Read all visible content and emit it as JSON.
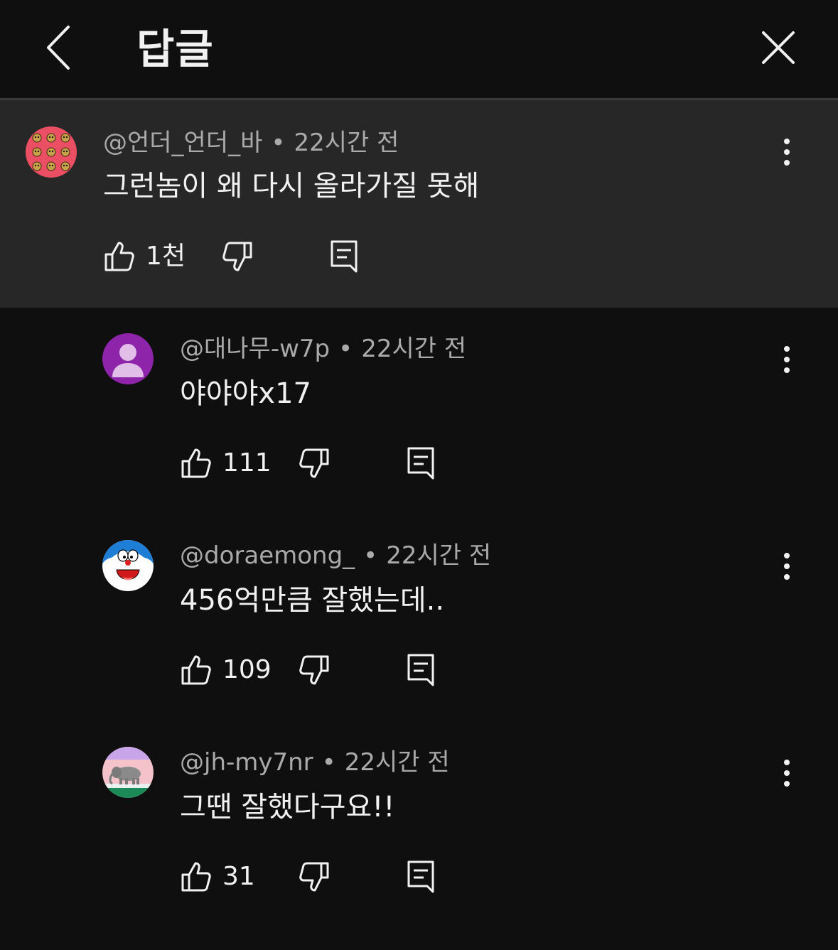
{
  "header": {
    "title": "답글",
    "back_icon": "chevron-left-icon",
    "close_icon": "close-icon"
  },
  "colors": {
    "background": "#0f0f0f",
    "parent_highlight": "#272727",
    "primary_text": "#f1f1f1",
    "secondary_text": "#aaaaaa"
  },
  "parent_comment": {
    "author": "@언더_언더_바",
    "time": "22시간 전",
    "text": "그런놈이 왜 다시 올라가질 못해",
    "likes": "1천",
    "avatar_icon": "tiger-pattern-avatar"
  },
  "replies": [
    {
      "author": "@대나무-w7p",
      "time": "22시간 전",
      "text": "야야야x17",
      "likes": "111",
      "avatar_icon": "default-person-avatar"
    },
    {
      "author": "@doraemong_",
      "time": "22시간 전",
      "text": "456억만큼 잘했는데..",
      "likes": "109",
      "avatar_icon": "doraemon-avatar"
    },
    {
      "author": "@jh-my7nr",
      "time": "22시간 전",
      "text": "그땐 잘했다구요!!",
      "likes": "31",
      "avatar_icon": "elephant-illustration-avatar"
    }
  ],
  "separator": "•"
}
